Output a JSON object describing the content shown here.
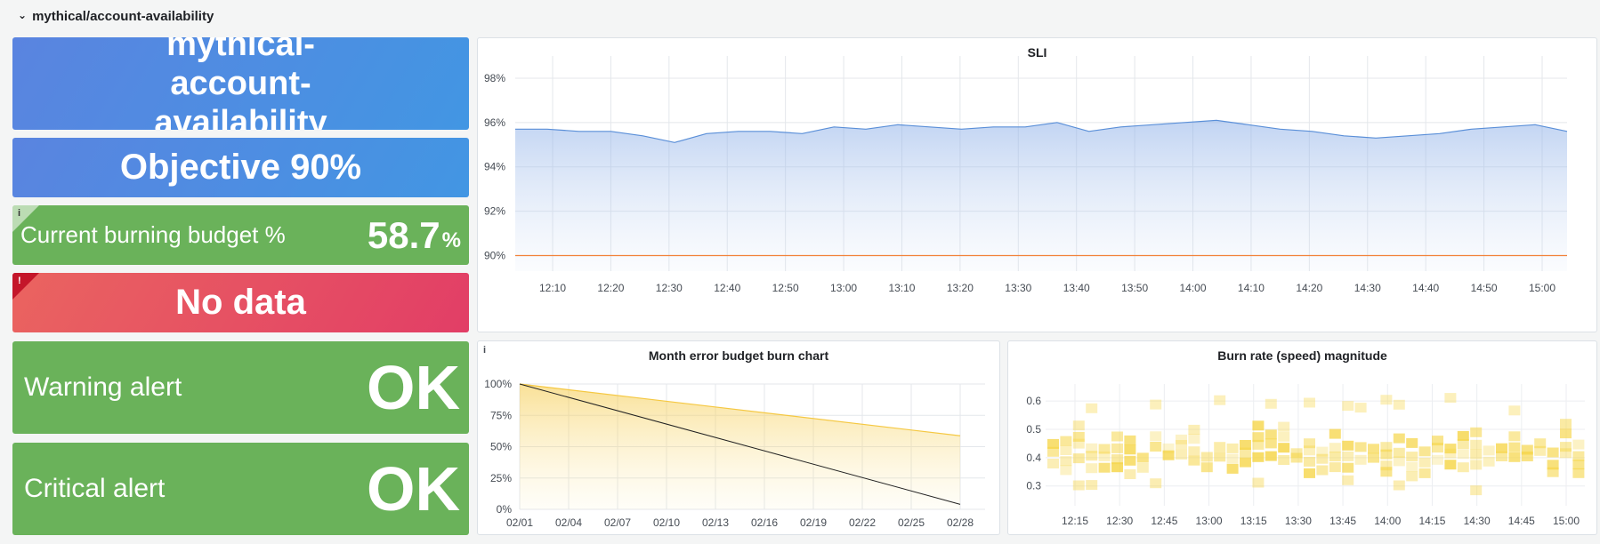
{
  "row": {
    "title": "mythical/account-availability",
    "chevron": "chevron-down-icon"
  },
  "stats": {
    "name": "mythical-account-availability",
    "objective": "Objective 90%",
    "burning": {
      "label": "Current burning budget %",
      "value": "58.7",
      "unit": "%",
      "info": "i"
    },
    "nodata": {
      "text": "No data",
      "err": "!"
    },
    "warning": {
      "label": "Warning alert",
      "value": "OK"
    },
    "critical": {
      "label": "Critical alert",
      "value": "OK"
    }
  },
  "colors": {
    "blue": "#4a8fe2",
    "green": "#6ab25a",
    "red": "#e34a63",
    "sli_line": "#5a8fd8",
    "objective_line": "#f2823a",
    "budget": "#f5c842",
    "heat": "#f5d33e"
  },
  "chart_data": [
    {
      "type": "area",
      "title": "SLI",
      "x": [
        "12:10",
        "12:20",
        "12:30",
        "12:40",
        "12:50",
        "13:00",
        "13:10",
        "13:20",
        "13:30",
        "13:40",
        "13:50",
        "14:00",
        "14:10",
        "14:20",
        "14:30",
        "14:40",
        "14:50",
        "15:00"
      ],
      "yticks": [
        "90%",
        "92%",
        "94%",
        "96%",
        "98%"
      ],
      "ylim": [
        89.3,
        99
      ],
      "series": [
        {
          "values": [
            95.7,
            95.7,
            95.6,
            95.6,
            95.4,
            95.1,
            95.5,
            95.6,
            95.6,
            95.5,
            95.8,
            95.7,
            95.9,
            95.8,
            95.7,
            95.8,
            95.8,
            96.0,
            95.6,
            95.8,
            95.9,
            96.0,
            96.1,
            95.9,
            95.7,
            95.6,
            95.4,
            95.3,
            95.4,
            95.5,
            95.7,
            95.8,
            95.9,
            95.6
          ]
        },
        {
          "values": [
            90.0,
            90.0
          ]
        }
      ]
    },
    {
      "type": "area",
      "title": "Month error budget burn chart",
      "x": [
        "02/01",
        "02/04",
        "02/07",
        "02/10",
        "02/13",
        "02/16",
        "02/19",
        "02/22",
        "02/25",
        "02/28"
      ],
      "yticks": [
        "0%",
        "25%",
        "50%",
        "75%",
        "100%"
      ],
      "ylim": [
        0,
        100
      ],
      "series": [
        {
          "values": [
            100,
            58.7
          ]
        },
        {
          "values": [
            100,
            4
          ]
        }
      ]
    },
    {
      "type": "heatmap",
      "title": "Burn rate (speed) magnitude",
      "x": [
        "12:15",
        "12:30",
        "12:45",
        "13:00",
        "13:15",
        "13:30",
        "13:45",
        "14:00",
        "14:15",
        "14:30",
        "14:45",
        "15:00"
      ],
      "yticks": [
        "0.3",
        "0.4",
        "0.5",
        "0.6"
      ],
      "ylim": [
        0.23,
        0.66
      ]
    }
  ]
}
